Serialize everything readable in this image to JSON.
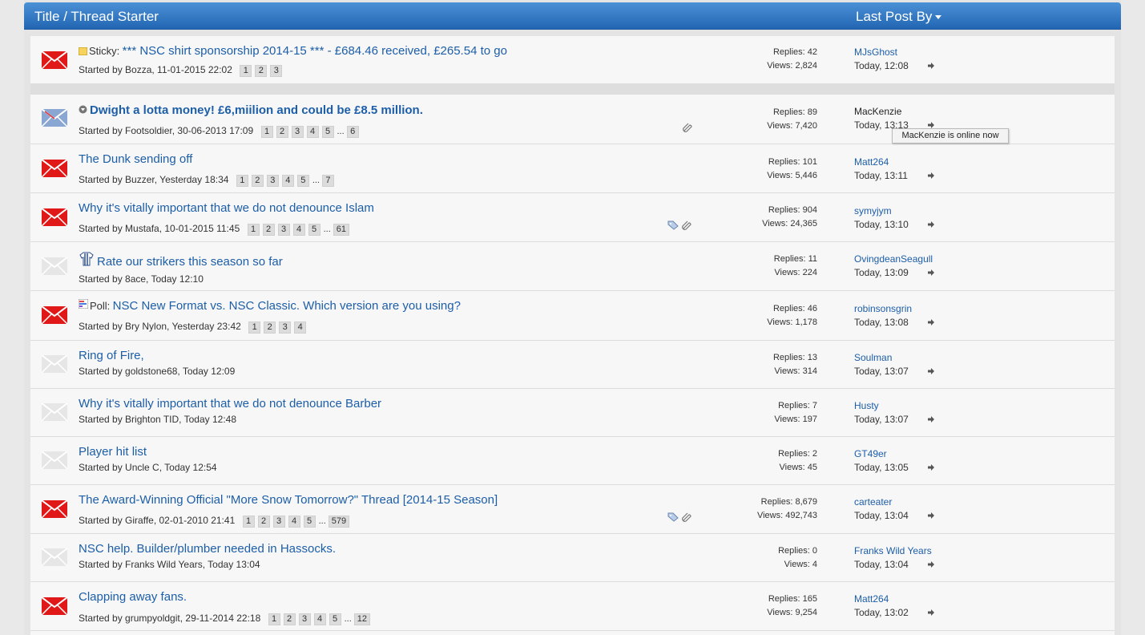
{
  "header": {
    "title": "Title / Thread Starter",
    "last_post": "Last Post By"
  },
  "tooltip": "MacKenzie is online now",
  "sticky": {
    "prefix": "Sticky:",
    "title": "*** NSC shirt sponsorship 2014-15 *** - £684.46 received, £265.54 to go",
    "started": "Started by Bozza, 11-01-2015 22:02",
    "pages": [
      "1",
      "2",
      "3"
    ],
    "replies": "Replies: 42",
    "views": "Views: 2,824",
    "last_user": "MJsGhost",
    "last_time": "Today, 12:08"
  },
  "threads": [
    {
      "title": "Dwight a lotta money! £6,miilion and could be £8.5 million.",
      "started": "Started by Footsoldier, 30-06-2013 17:09",
      "pages": [
        "1",
        "2",
        "3",
        "4",
        "5"
      ],
      "last_page": "6",
      "ellipsis": "...",
      "replies": "Replies: 89",
      "views": "Views: 7,420",
      "last_user": "MacKenzie",
      "last_time": "Today, 13:13"
    },
    {
      "title": "The Dunk sending off",
      "started": "Started by Buzzer, Yesterday 18:34",
      "pages": [
        "1",
        "2",
        "3",
        "4",
        "5"
      ],
      "last_page": "7",
      "ellipsis": "...",
      "replies": "Replies: 101",
      "views": "Views: 5,446",
      "last_user": "Matt264",
      "last_time": "Today, 13:11"
    },
    {
      "title": "Why it's vitally important that we do not denounce Islam",
      "started": "Started by Mustafa, 10-01-2015 11:45",
      "pages": [
        "1",
        "2",
        "3",
        "4",
        "5"
      ],
      "last_page": "61",
      "ellipsis": "...",
      "replies": "Replies: 904",
      "views": "Views: 24,365",
      "last_user": "symyjym",
      "last_time": "Today, 13:10"
    },
    {
      "title": "Rate our strikers this season so far",
      "started": "Started by 8ace, Today 12:10",
      "replies": "Replies: 11",
      "views": "Views: 224",
      "last_user": "OvingdeanSeagull",
      "last_time": "Today, 13:09"
    },
    {
      "prefix": "Poll:",
      "title": "NSC New Format vs. NSC Classic. Which version are you using?",
      "started": "Started by Bry Nylon, Yesterday 23:42",
      "pages": [
        "1",
        "2",
        "3",
        "4"
      ],
      "replies": "Replies: 46",
      "views": "Views: 1,178",
      "last_user": "robinsonsgrin",
      "last_time": "Today, 13:08"
    },
    {
      "title": "Ring of Fire,",
      "started": "Started by goldstone68, Today 12:09",
      "replies": "Replies: 13",
      "views": "Views: 314",
      "last_user": "Soulman",
      "last_time": "Today, 13:07"
    },
    {
      "title": "Why it's vitally important that we do not denounce Barber",
      "started": "Started by Brighton TID, Today 12:48",
      "replies": "Replies: 7",
      "views": "Views: 197",
      "last_user": "Husty",
      "last_time": "Today, 13:07"
    },
    {
      "title": "Player hit list",
      "started": "Started by Uncle C, Today 12:54",
      "replies": "Replies: 2",
      "views": "Views: 45",
      "last_user": "GT49er",
      "last_time": "Today, 13:05"
    },
    {
      "title": "The Award-Winning Official \"More Snow Tomorrow?\" Thread [2014-15 Season]",
      "started": "Started by Giraffe, 02-01-2010 21:41",
      "pages": [
        "1",
        "2",
        "3",
        "4",
        "5"
      ],
      "last_page": "579",
      "ellipsis": "...",
      "replies": "Replies: 8,679",
      "views": "Views: 492,743",
      "last_user": "carteater",
      "last_time": "Today, 13:04"
    },
    {
      "title": "NSC help. Builder/plumber needed in Hassocks.",
      "started": "Started by Franks Wild Years, Today 13:04",
      "replies": "Replies: 0",
      "views": "Views: 4",
      "last_user": "Franks Wild Years",
      "last_time": "Today, 13:04"
    },
    {
      "title": "Clapping away fans.",
      "started": "Started by grumpyoldgit, 29-11-2014 22:18",
      "pages": [
        "1",
        "2",
        "3",
        "4",
        "5"
      ],
      "last_page": "12",
      "ellipsis": "...",
      "replies": "Replies: 165",
      "views": "Views: 9,254",
      "last_user": "Matt264",
      "last_time": "Today, 13:02"
    }
  ]
}
